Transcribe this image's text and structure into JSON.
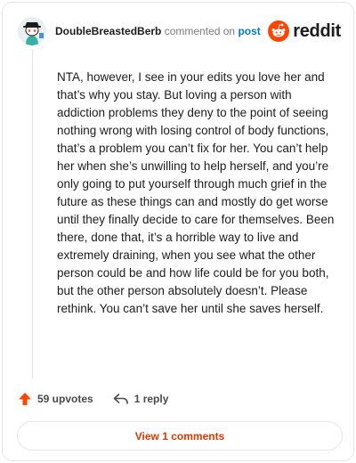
{
  "header": {
    "username": "DoubleBreastedBerb",
    "action_text": "commented on",
    "post_link": "post",
    "brand": "reddit"
  },
  "comment": {
    "text": "NTA, however, I see in your edits you love her and that’s why you stay. But loving a person with addiction problems they deny to the point of seeing nothing wrong with losing control of body functions, that’s a problem you can’t fix for her. You can’t help her when she’s unwilling to help herself, and you’re only going to put yourself through much grief in the future as these things can and mostly do get worse until they finally decide to care for themselves. Been there, done that, it’s a horrible way to live and extremely draining, when you see what the other person could be and how life could be for you both, but the other person absolutely doesn’t. Please rethink. You can’t save her until she saves herself."
  },
  "actions": {
    "upvotes": "59 upvotes",
    "replies": "1 reply"
  },
  "view_comments": "View 1 comments",
  "colors": {
    "brand_orange": "#ff4500",
    "link_blue": "#0079d3",
    "button_text": "#d93a00"
  },
  "icons": {
    "avatar": "snoo-avatar",
    "logo": "reddit-snoo-icon",
    "upvote": "upvote-arrow-icon",
    "reply": "reply-arrow-icon"
  }
}
